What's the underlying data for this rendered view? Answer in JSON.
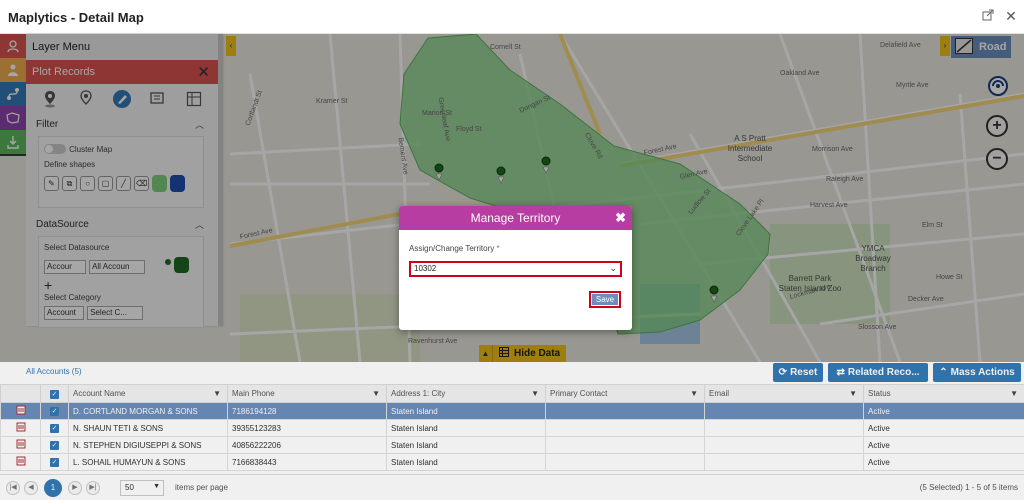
{
  "window": {
    "title": "Maplytics - Detail Map"
  },
  "layer_panel": {
    "title": "Layer Menu",
    "plot_records": "Plot Records",
    "filter_title": "Filter",
    "cluster_map": "Cluster Map",
    "define_shapes": "Define shapes",
    "datasource_title": "DataSource",
    "select_datasource": "Select Datasource",
    "datasource_value": "Accour",
    "view_value": "All Accoun",
    "select_category": "Select Category",
    "category_entity": "Account",
    "category_value": "Select C..."
  },
  "map": {
    "road_label": "Road",
    "hide_data": "Hide Data",
    "streets": [
      "Cornell St",
      "Delafield Ave",
      "Oakland Ave",
      "Marion St",
      "Floyd St",
      "Kramer St",
      "Cortlandt St",
      "Dongan St",
      "Clove Rd",
      "Forest Ave",
      "Forest Ave",
      "Myrtle Ave",
      "Morrison Ave",
      "Raleigh Ave",
      "Harvest Ave",
      "Glen Ave",
      "Ludlow St",
      "Howe St",
      "Elm St",
      "Decker Ave",
      "Ravenhurst Ave",
      "Slosson Ave",
      "Clove Lake Pl",
      "Greenleaf Ave",
      "Bement Ave",
      "Lockman Ave"
    ],
    "places": [
      "A S Pratt\nIntermediate\nSchool",
      "Barrett Park\nStaten Island Zoo",
      "YMCA\nBroadway\nBranch"
    ]
  },
  "modal": {
    "title": "Manage Territory",
    "field_label": "Assign/Change Territory",
    "required_mark": "*",
    "territory_value": "10302",
    "save_label": "Save"
  },
  "grid": {
    "tab_label": "All Accounts (5)",
    "buttons": {
      "reset": "Reset",
      "related": "Related Reco...",
      "mass": "Mass Actions"
    },
    "columns": [
      "Account Name",
      "Main Phone",
      "Address 1: City",
      "Primary Contact",
      "Email",
      "Status"
    ],
    "rows": [
      {
        "name": "D. CORTLAND MORGAN & SONS",
        "phone": "7186194128",
        "city": "Staten Island",
        "contact": "",
        "email": "",
        "status": "Active"
      },
      {
        "name": "N. SHAUN TETI & SONS",
        "phone": "39355123283",
        "city": "Staten Island",
        "contact": "",
        "email": "",
        "status": "Active"
      },
      {
        "name": "N. STEPHEN DIGIUSEPPI & SONS",
        "phone": "40856222206",
        "city": "Staten Island",
        "contact": "",
        "email": "",
        "status": "Active"
      },
      {
        "name": "L. SOHAIL HUMAYUN & SONS",
        "phone": "7166838443",
        "city": "Staten Island",
        "contact": "",
        "email": "",
        "status": "Active"
      }
    ],
    "pager": {
      "current_page": "1",
      "page_size": "50",
      "items_per_page": "items per page",
      "summary": "(5 Selected) 1 - 5 of 5 items"
    }
  },
  "colors": {
    "accent": "#337ab7",
    "modal_header": "#b73da3",
    "territory_fill": "#7fd07f",
    "highlight_border": "#d0021b",
    "plot_header": "#d9534f"
  }
}
